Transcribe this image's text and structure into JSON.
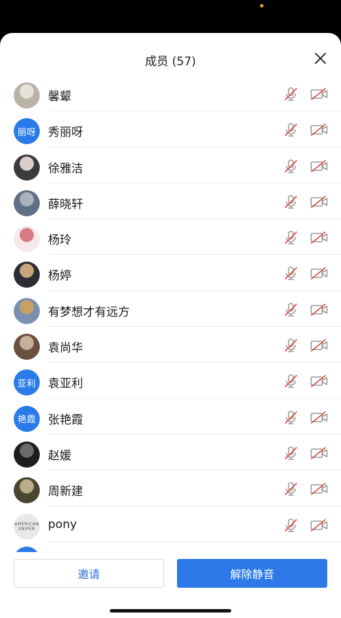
{
  "header": {
    "title": "成员 (57)"
  },
  "members": [
    {
      "name": "馨颦",
      "avatar_type": "photo",
      "avatar_colors": [
        "#b9b2a6",
        "#e7e2d8"
      ]
    },
    {
      "name": "秀丽呀",
      "avatar_type": "text",
      "avatar_text": "丽呀"
    },
    {
      "name": "徐雅洁",
      "avatar_type": "photo",
      "avatar_colors": [
        "#3b3b3b",
        "#d9cfc8"
      ]
    },
    {
      "name": "薛晓轩",
      "avatar_type": "photo",
      "avatar_colors": [
        "#5f6f85",
        "#aab3be"
      ]
    },
    {
      "name": "杨玲",
      "avatar_type": "photo",
      "avatar_colors": [
        "#f6e9ea",
        "#d97b83"
      ]
    },
    {
      "name": "杨婷",
      "avatar_type": "photo",
      "avatar_colors": [
        "#2c2c34",
        "#c9a57c"
      ]
    },
    {
      "name": "有梦想才有远方",
      "avatar_type": "photo",
      "avatar_colors": [
        "#7a8fb2",
        "#c9a064"
      ]
    },
    {
      "name": "袁尚华",
      "avatar_type": "photo",
      "avatar_colors": [
        "#6b4f3f",
        "#c6b09a"
      ]
    },
    {
      "name": "袁亚利",
      "avatar_type": "text",
      "avatar_text": "亚利"
    },
    {
      "name": "张艳霞",
      "avatar_type": "text",
      "avatar_text": "艳霞"
    },
    {
      "name": "赵媛",
      "avatar_type": "photo",
      "avatar_colors": [
        "#1d1d1d",
        "#6a6a6a"
      ]
    },
    {
      "name": "周新建",
      "avatar_type": "photo",
      "avatar_colors": [
        "#4a4632",
        "#b9ad8a"
      ]
    },
    {
      "name": "pony",
      "avatar_type": "logo",
      "avatar_text": "AMERICAN SNIPER",
      "avatar_colors": [
        "#e9e9e9",
        "#555555"
      ]
    },
    {
      "name": "",
      "avatar_type": "text",
      "avatar_text": ""
    }
  ],
  "footer": {
    "invite_label": "邀请",
    "unmute_label": "解除静音"
  },
  "colors": {
    "accent": "#2d79ea",
    "muted_slash": "#e0453d",
    "icon_gray": "#9a9a9a"
  },
  "icons": {
    "mic": "mic-muted-icon",
    "camera": "camera-off-icon",
    "close": "close-icon"
  }
}
